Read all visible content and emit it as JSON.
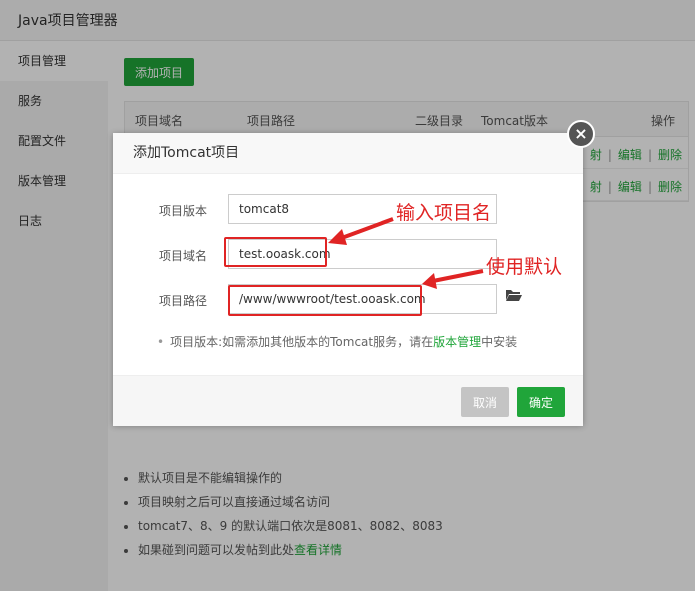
{
  "window": {
    "title": "Java项目管理器"
  },
  "sidebar": {
    "items": [
      {
        "label": "项目管理"
      },
      {
        "label": "服务"
      },
      {
        "label": "配置文件"
      },
      {
        "label": "版本管理"
      },
      {
        "label": "日志"
      }
    ]
  },
  "main": {
    "add_button": "添加项目",
    "table": {
      "headers": [
        "项目域名",
        "项目路径",
        "二级目录",
        "Tomcat版本",
        "操作"
      ],
      "rows": [
        {
          "ops": {
            "partial": "射",
            "edit": "编辑",
            "delete": "删除"
          }
        },
        {
          "ops": {
            "partial": "射",
            "edit": "编辑",
            "delete": "删除"
          }
        }
      ],
      "separator": "|"
    },
    "notes": [
      {
        "text": "默认项目是不能编辑操作的"
      },
      {
        "text": "项目映射之后可以直接通过域名访问"
      },
      {
        "text": "tomcat7、8、9 的默认端口依次是8081、8082、8083"
      },
      {
        "text": "如果碰到问题可以发帖到此处",
        "link": "查看详情"
      }
    ]
  },
  "modal": {
    "title": "添加Tomcat项目",
    "close_glyph": "×",
    "fields": {
      "version": {
        "label": "项目版本",
        "value": "tomcat8"
      },
      "domain": {
        "label": "项目域名",
        "value": "test.ooask.com"
      },
      "path": {
        "label": "项目路径",
        "value": "/www/wwwroot/test.ooask.com"
      }
    },
    "tip": {
      "text": "项目版本:如需添加其他版本的Tomcat服务，请在",
      "link": "版本管理",
      "suffix": "中安装",
      "bullet": "•"
    },
    "cancel": "取消",
    "ok": "确定"
  },
  "annotations": {
    "domain_note": "输入项目名",
    "path_note": "使用默认"
  },
  "colors": {
    "accent": "#20a53a",
    "annotation": "#e02424",
    "overlay": "rgba(0,0,0,0.3)"
  }
}
